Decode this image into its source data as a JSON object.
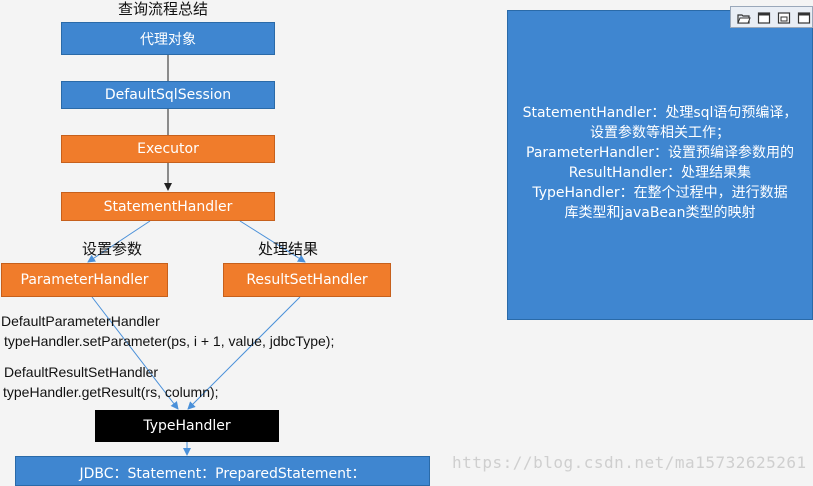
{
  "diagram": {
    "title": "查询流程总结",
    "nodes": {
      "proxy": "代理对象",
      "sqlsession": "DefaultSqlSession",
      "executor": "Executor",
      "statement": "StatementHandler",
      "parameter": "ParameterHandler",
      "resultset": "ResultSetHandler",
      "typehandler": "TypeHandler",
      "jdbc": "JDBC：Statement：PreparedStatement："
    },
    "edge_labels": {
      "set_params": "设置参数",
      "handle_result": "处理结果"
    },
    "code_notes": {
      "param_class": "DefaultParameterHandler",
      "param_call": "typeHandler.setParameter(ps, i + 1, value, jdbcType);",
      "result_class": "DefaultResultSetHandler",
      "result_call": "typeHandler.getResult(rs, column);"
    },
    "colors": {
      "blue": "#3f86d0",
      "orange": "#f07c2b",
      "black": "#000000"
    }
  },
  "notes_panel": {
    "lines": [
      "StatementHandler：处理sql语句预编译，",
      "设置参数等相关工作；",
      "ParameterHandler：设置预编译参数用的",
      "ResultHandler：处理结果集",
      "TypeHandler：在整个过程中，进行数据",
      "库类型和javaBean类型的映射"
    ]
  },
  "toolbar": {
    "icons": [
      "open-folder-icon",
      "window-icon",
      "restore-icon",
      "maximize-icon"
    ]
  },
  "watermark": "https://blog.csdn.net/ma15732625261"
}
